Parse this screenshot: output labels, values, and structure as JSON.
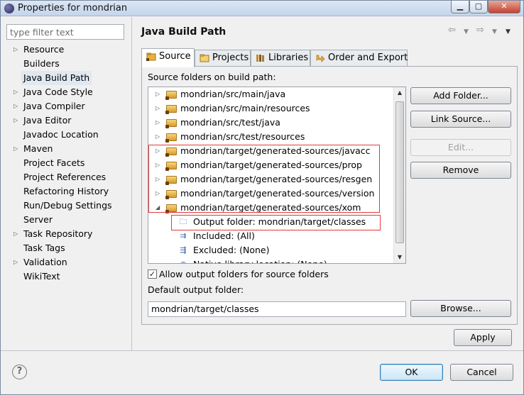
{
  "window": {
    "title": "Properties for mondrian"
  },
  "filter": {
    "placeholder": "type filter text"
  },
  "nav": {
    "items": [
      {
        "label": "Resource",
        "expandable": true
      },
      {
        "label": "Builders",
        "expandable": false
      },
      {
        "label": "Java Build Path",
        "expandable": false,
        "selected": true
      },
      {
        "label": "Java Code Style",
        "expandable": true
      },
      {
        "label": "Java Compiler",
        "expandable": true
      },
      {
        "label": "Java Editor",
        "expandable": true
      },
      {
        "label": "Javadoc Location",
        "expandable": false
      },
      {
        "label": "Maven",
        "expandable": true
      },
      {
        "label": "Project Facets",
        "expandable": false
      },
      {
        "label": "Project References",
        "expandable": false
      },
      {
        "label": "Refactoring History",
        "expandable": false
      },
      {
        "label": "Run/Debug Settings",
        "expandable": false
      },
      {
        "label": "Server",
        "expandable": false
      },
      {
        "label": "Task Repository",
        "expandable": true
      },
      {
        "label": "Task Tags",
        "expandable": false
      },
      {
        "label": "Validation",
        "expandable": true
      },
      {
        "label": "WikiText",
        "expandable": false
      }
    ]
  },
  "page": {
    "title": "Java Build Path"
  },
  "tabs": [
    {
      "label": "Source",
      "icon": "source-folder-icon",
      "active": true
    },
    {
      "label": "Projects",
      "icon": "projects-icon"
    },
    {
      "label": "Libraries",
      "icon": "libraries-icon"
    },
    {
      "label": "Order and Export",
      "icon": "order-export-icon"
    }
  ],
  "source": {
    "label": "Source folders on build path:",
    "tree": [
      {
        "label": "mondrian/src/main/java",
        "level": 0,
        "state": "collapsed",
        "icon": "source-folder-icon"
      },
      {
        "label": "mondrian/src/main/resources",
        "level": 0,
        "state": "collapsed",
        "icon": "source-folder-icon"
      },
      {
        "label": "mondrian/src/test/java",
        "level": 0,
        "state": "collapsed",
        "icon": "source-folder-icon"
      },
      {
        "label": "mondrian/src/test/resources",
        "level": 0,
        "state": "collapsed",
        "icon": "source-folder-icon"
      },
      {
        "label": "mondrian/target/generated-sources/javacc",
        "level": 0,
        "state": "collapsed",
        "icon": "source-folder-icon"
      },
      {
        "label": "mondrian/target/generated-sources/prop",
        "level": 0,
        "state": "collapsed",
        "icon": "source-folder-icon"
      },
      {
        "label": "mondrian/target/generated-sources/resgen",
        "level": 0,
        "state": "collapsed",
        "icon": "source-folder-icon"
      },
      {
        "label": "mondrian/target/generated-sources/version",
        "level": 0,
        "state": "collapsed",
        "icon": "source-folder-icon"
      },
      {
        "label": "mondrian/target/generated-sources/xom",
        "level": 0,
        "state": "expanded",
        "icon": "source-folder-icon"
      },
      {
        "label": "Output folder: mondrian/target/classes",
        "level": 1,
        "state": "leaf",
        "icon": "output-folder-icon"
      },
      {
        "label": "Included: (All)",
        "level": 1,
        "state": "leaf",
        "icon": "included-filter-icon"
      },
      {
        "label": "Excluded: (None)",
        "level": 1,
        "state": "leaf",
        "icon": "excluded-filter-icon"
      },
      {
        "label": "Native library location: (None)",
        "level": 1,
        "state": "leaf",
        "icon": "native-library-icon"
      }
    ]
  },
  "buttons": {
    "add_folder": "Add Folder...",
    "link_source": "Link Source...",
    "edit": "Edit...",
    "remove": "Remove",
    "browse": "Browse...",
    "apply": "Apply",
    "ok": "OK",
    "cancel": "Cancel"
  },
  "allow_output": {
    "label": "Allow output folders for source folders",
    "checked": true
  },
  "default_output": {
    "label": "Default output folder:",
    "value": "mondrian/target/classes"
  },
  "colors": {
    "highlight": "#e23b3b",
    "selection": "#e0e8f1"
  }
}
